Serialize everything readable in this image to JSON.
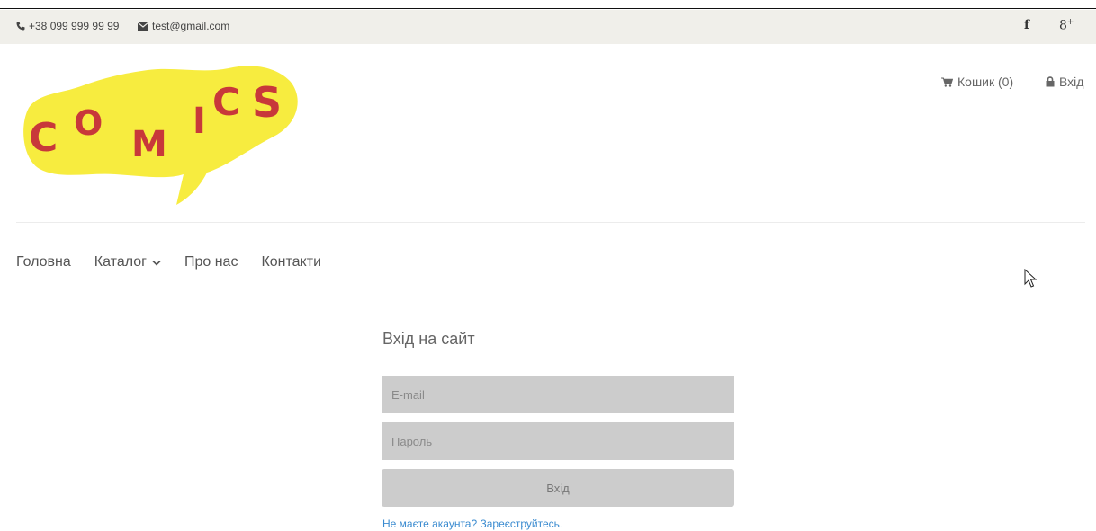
{
  "topbar": {
    "phone": "+38 099 999 99 99",
    "email": "test@gmail.com",
    "facebook_icon": "f",
    "googleplus_icon": "g+"
  },
  "logo": {
    "letters": [
      "C",
      "O",
      "M",
      "I",
      "C",
      "S"
    ],
    "bubble_color": "#f7ec3f",
    "letter_color": "#c8383a"
  },
  "header": {
    "cart_label": "Кошик (0)",
    "login_label": "Вхід"
  },
  "nav": {
    "items": [
      {
        "label": "Головна"
      },
      {
        "label": "Каталог"
      },
      {
        "label": "Про нас"
      },
      {
        "label": "Контакти"
      }
    ]
  },
  "login_form": {
    "title": "Вхід на сайт",
    "email_placeholder": "E-mail",
    "password_placeholder": "Пароль",
    "submit_label": "Вхід",
    "register_text": "Не маєте акаунта? Зареєструйтесь."
  },
  "colors": {
    "topbar_bg": "#f0efea",
    "input_bg": "#cccccc",
    "link": "#3a8bd0"
  }
}
